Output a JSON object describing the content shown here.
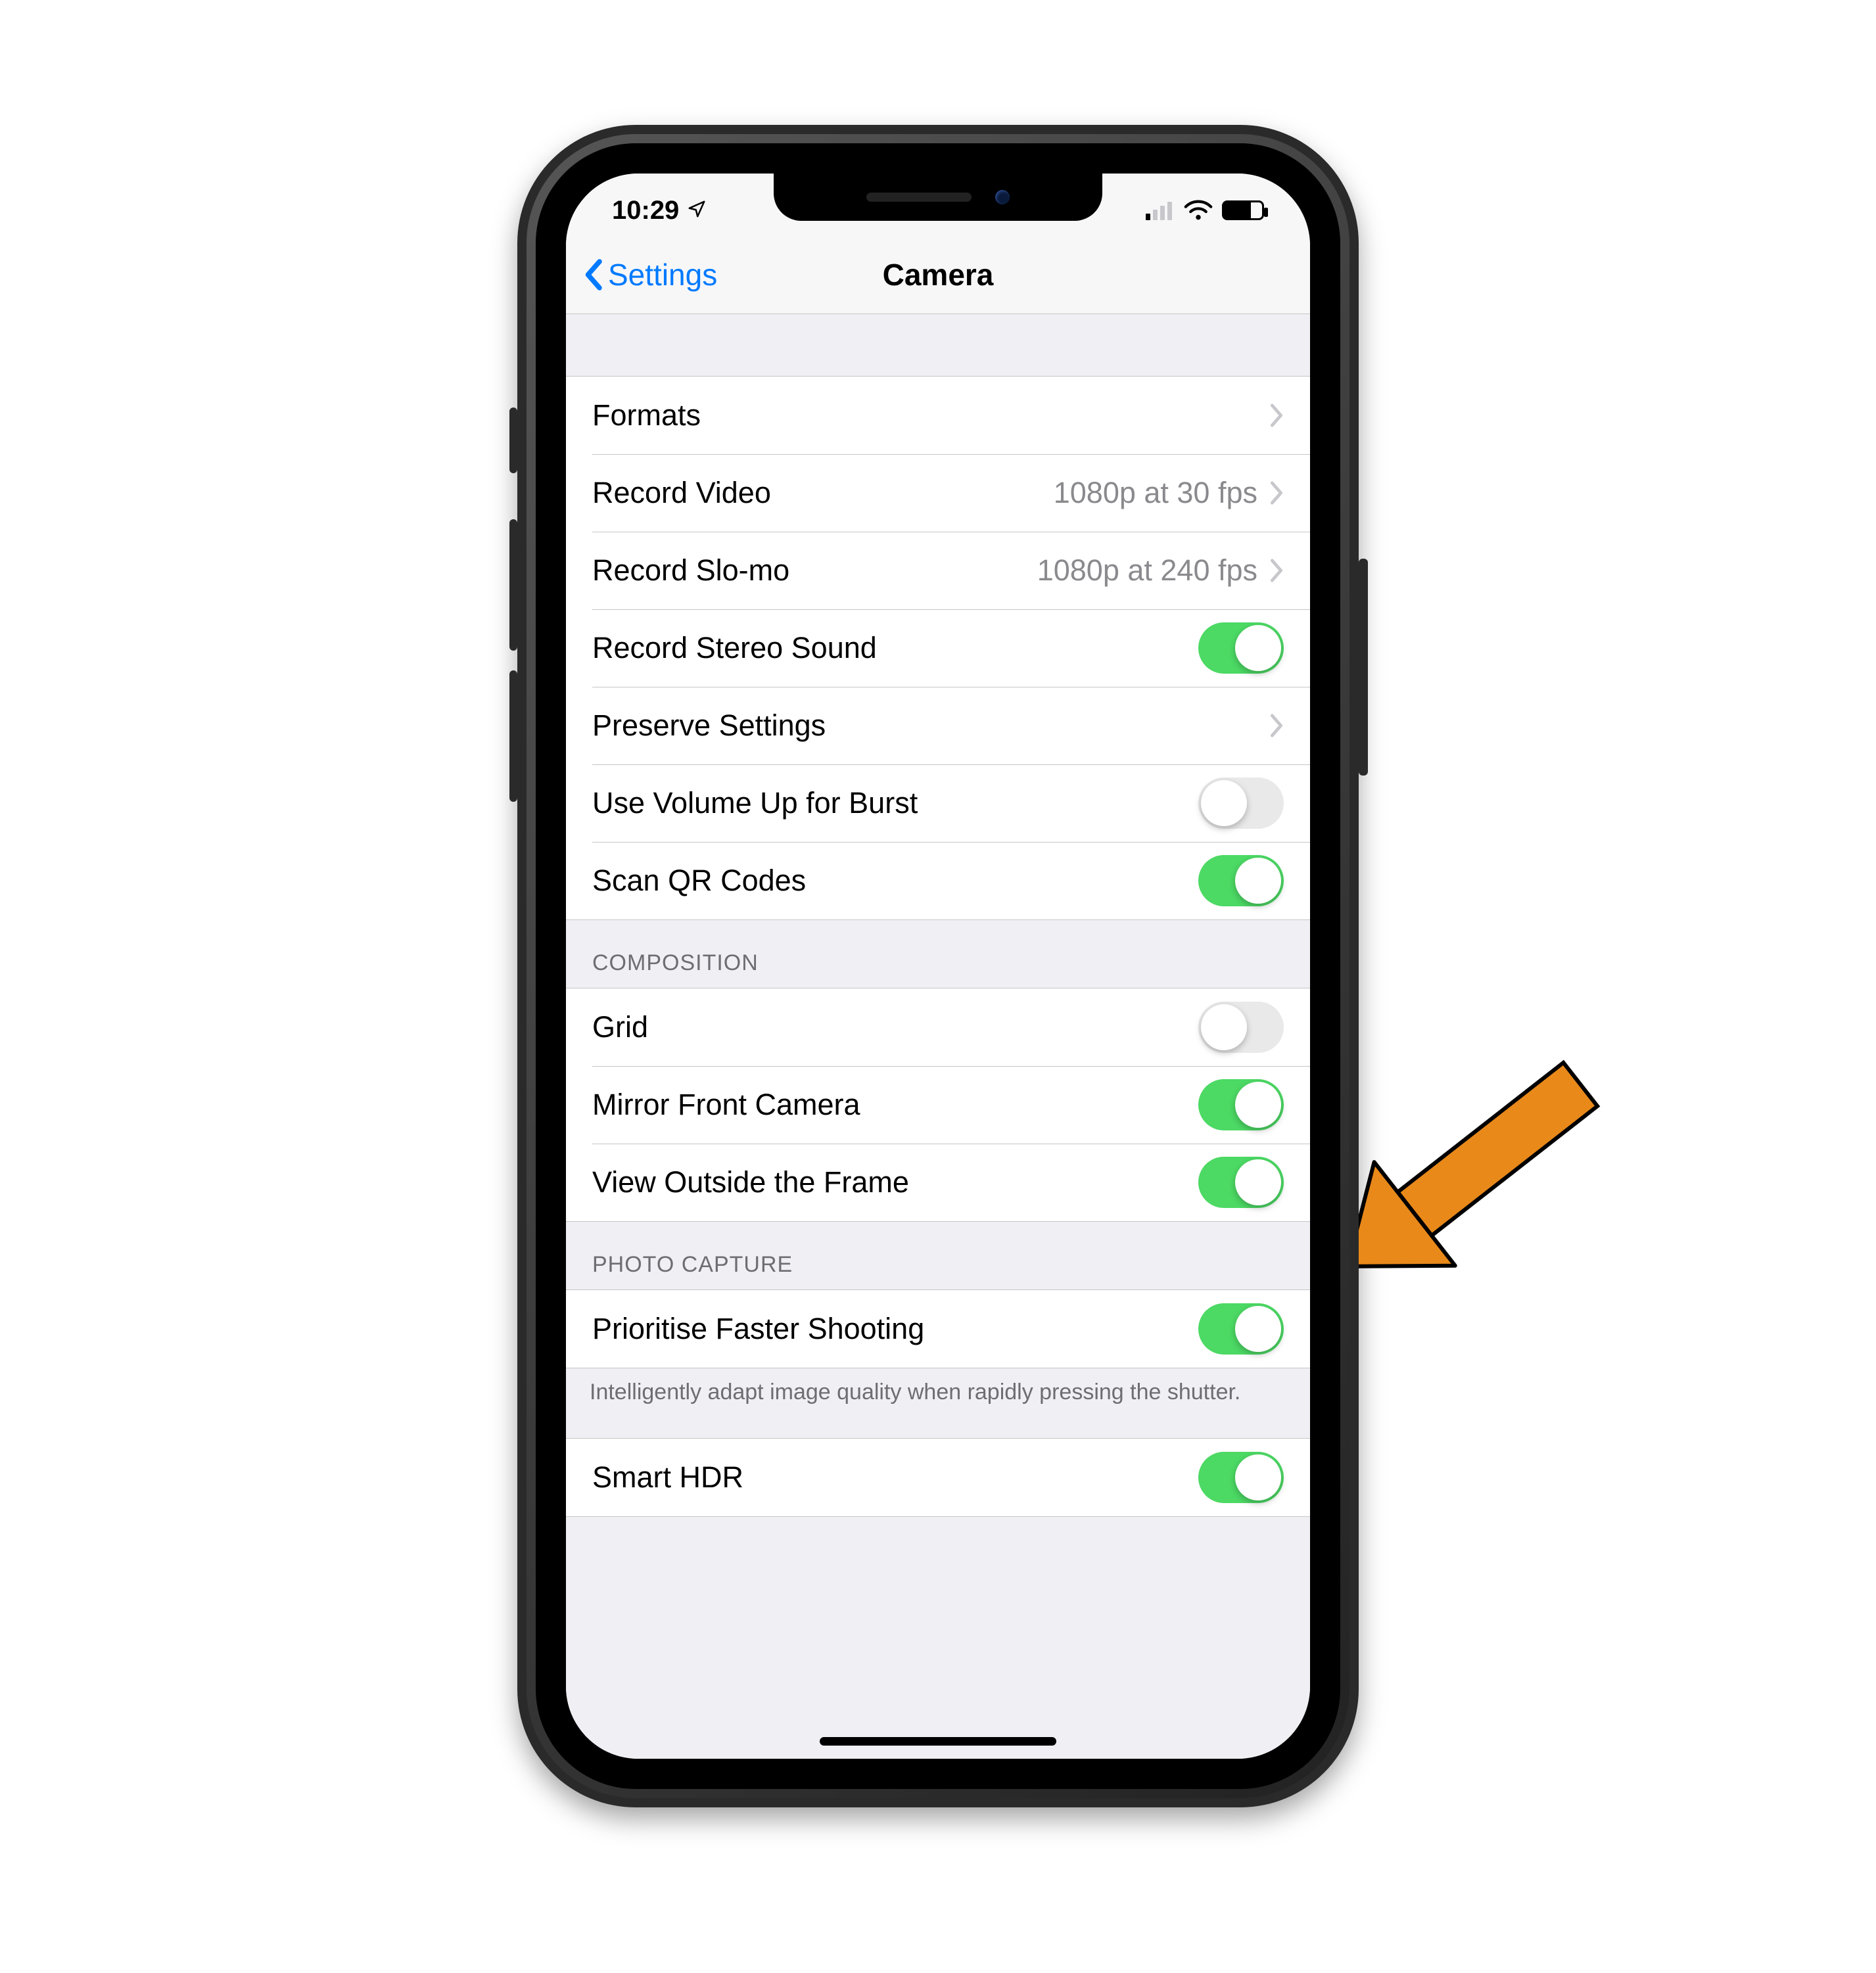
{
  "status": {
    "time": "10:29",
    "location_icon": "location-arrow"
  },
  "nav": {
    "back_label": "Settings",
    "title": "Camera"
  },
  "rows": {
    "formats": {
      "label": "Formats"
    },
    "record_video": {
      "label": "Record Video",
      "value": "1080p at 30 fps"
    },
    "record_slomo": {
      "label": "Record Slo-mo",
      "value": "1080p at 240 fps"
    },
    "stereo_sound": {
      "label": "Record Stereo Sound",
      "on": true
    },
    "preserve": {
      "label": "Preserve Settings"
    },
    "volume_burst": {
      "label": "Use Volume Up for Burst",
      "on": false
    },
    "scan_qr": {
      "label": "Scan QR Codes",
      "on": true
    },
    "grid": {
      "label": "Grid",
      "on": false
    },
    "mirror_front": {
      "label": "Mirror Front Camera",
      "on": true
    },
    "outside_frame": {
      "label": "View Outside the Frame",
      "on": true
    },
    "faster_shooting": {
      "label": "Prioritise Faster Shooting",
      "on": true
    },
    "smart_hdr": {
      "label": "Smart HDR",
      "on": true
    }
  },
  "sections": {
    "composition_header": "COMPOSITION",
    "photo_capture_header": "PHOTO CAPTURE",
    "faster_shooting_footer": "Intelligently adapt image quality when rapidly pressing the shutter."
  },
  "colors": {
    "ios_blue": "#007aff",
    "toggle_green": "#4cd964",
    "annotation_orange": "#e8891a"
  }
}
